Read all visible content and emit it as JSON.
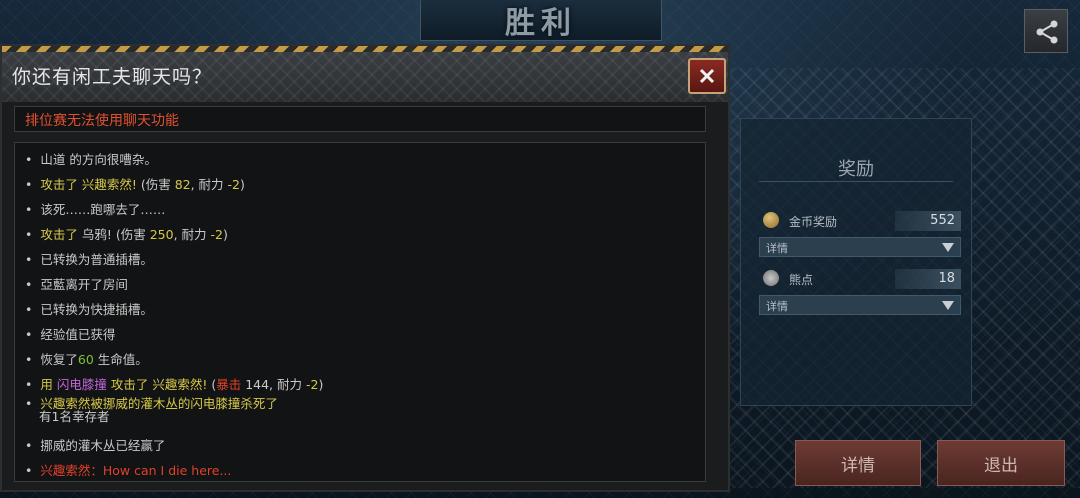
{
  "header": {
    "title": "胜利"
  },
  "share": {
    "icon": "share-icon"
  },
  "reward": {
    "title": "奖励",
    "gold": {
      "label": "金币奖励",
      "value": "552",
      "detail": "详情",
      "icon": "coin-icon"
    },
    "bear": {
      "label": "熊点",
      "value": "18",
      "detail": "详情",
      "icon": "bear-paw-icon"
    }
  },
  "buttons": {
    "details": "详情",
    "exit": "退出"
  },
  "dialog": {
    "title": "你还有闲工夫聊天吗？",
    "warning": "排位赛无法使用聊天功能",
    "log": [
      {
        "bullet": "•",
        "parts": [
          "山道 的方向很嘈杂。"
        ]
      },
      {
        "bullet": "•",
        "parts": [
          "攻击了 兴趣索然!",
          " (伤害 ",
          "82",
          ",  耐力 ",
          " -2",
          ")"
        ]
      },
      {
        "bullet": "•",
        "parts": [
          "该死……跑哪去了……"
        ]
      },
      {
        "bullet": "•",
        "parts": [
          "攻击了",
          " 乌鸦! (伤害 ",
          "250",
          ",  耐力 ",
          " -2",
          ")"
        ]
      },
      {
        "bullet": "•",
        "parts": [
          "已转换为普通插槽。"
        ]
      },
      {
        "bullet": "•",
        "parts": [
          "亞藍离开了房间"
        ]
      },
      {
        "bullet": "•",
        "parts": [
          "已转换为快捷插槽。"
        ]
      },
      {
        "bullet": "•",
        "parts": [
          "经验值已获得"
        ]
      },
      {
        "bullet": "•",
        "parts": [
          "恢复了",
          "60",
          " 生命值。"
        ]
      },
      {
        "bullet": "•",
        "parts": [
          "用 ",
          "闪电膝撞",
          " 攻击了 ",
          " 兴趣索然!",
          " (",
          "暴击",
          " 144,  耐力 ",
          " -2",
          ")"
        ]
      },
      {
        "bullet": "•",
        "parts": [
          "兴趣索然",
          "被挪威的灌木丛的闪电膝撞杀死了",
          "有1名幸存者"
        ]
      },
      {
        "bullet": "•",
        "parts": [
          "挪威的灌木丛已经赢了"
        ]
      },
      {
        "bullet": "•",
        "parts": [
          "兴趣索然：How can I die here..."
        ]
      }
    ]
  },
  "colors": {
    "accent_red": "#e0512f",
    "gold_text": "#d7c84a",
    "green_text": "#7fbf3a",
    "purple_text": "#c067d8"
  }
}
